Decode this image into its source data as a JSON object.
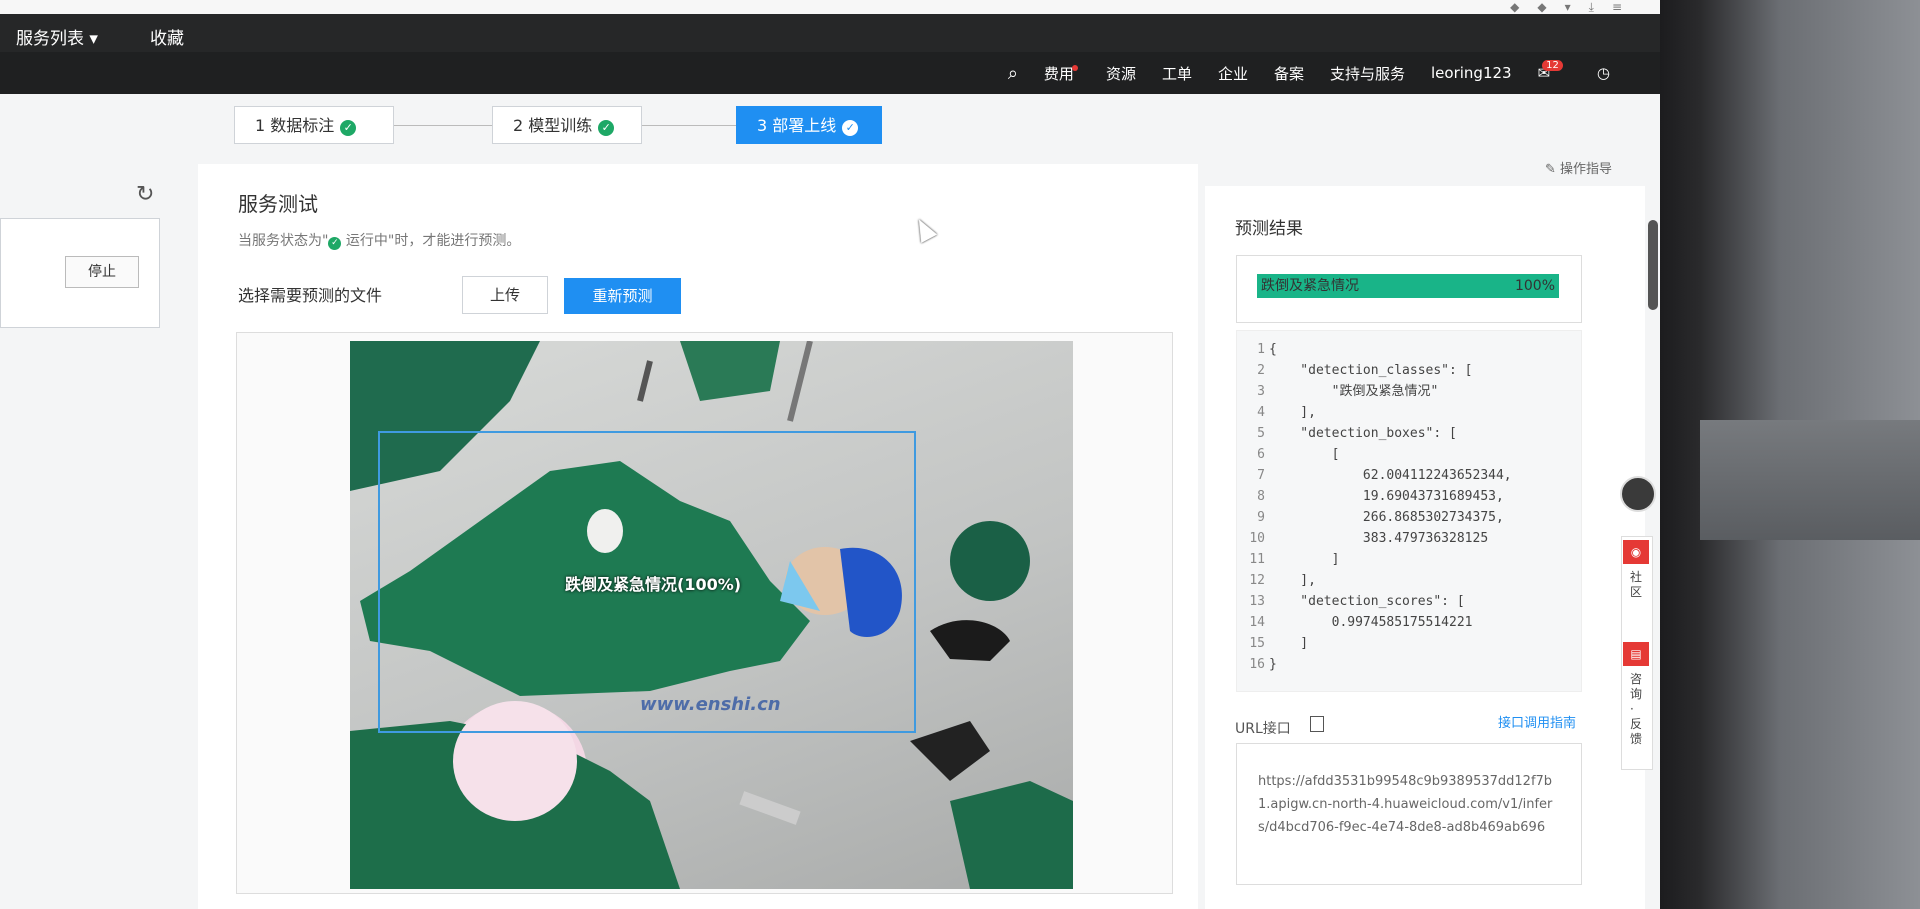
{
  "topnav": {
    "services_label": "服务列表",
    "favorites_label": "收藏"
  },
  "subnav": {
    "items": [
      "费用",
      "资源",
      "工单",
      "企业",
      "备案",
      "支持与服务"
    ],
    "user": "leoring123",
    "message_count": "12"
  },
  "steps": [
    {
      "label": "1 数据标注",
      "state": "done"
    },
    {
      "label": "2 模型训练",
      "state": "done"
    },
    {
      "label": "3 部署上线",
      "state": "active"
    }
  ],
  "guide_label": "操作指导",
  "left": {
    "stop_label": "停止"
  },
  "main": {
    "title": "服务测试",
    "hint_prefix": "当服务状态为\"",
    "hint_status": "运行中",
    "hint_suffix": "\"时，才能进行预测。",
    "select_label": "选择需要预测的文件",
    "upload_label": "上传",
    "repredict_label": "重新预测",
    "detection_label": "跌倒及紧急情况(100%)",
    "watermark": "www.enshi.cn"
  },
  "results": {
    "title": "预测结果",
    "class_label": "跌倒及紧急情况",
    "percent": "100%",
    "percent_value": 1.0,
    "code_lines": [
      "{",
      "    \"detection_classes\": [",
      "        \"跌倒及紧急情况\"",
      "    ],",
      "    \"detection_boxes\": [",
      "        [",
      "            62.004112243652344,",
      "            19.69043731689453,",
      "            266.8685302734375,",
      "            383.479736328125",
      "        ]",
      "    ],",
      "    \"detection_scores\": [",
      "        0.9974585175514221",
      "    ]",
      "}"
    ],
    "url_label": "URL接口",
    "api_guide_label": "接口调用指南",
    "url": "https://afdd3531b99548c9b9389537dd12f7b1.apigw.cn-north-4.huaweicloud.com/v1/infers/d4bcd706-f9ec-4e74-8de8-ad8b469ab696"
  },
  "floatbar": {
    "community": "社区",
    "consult": "咨询·反馈"
  }
}
